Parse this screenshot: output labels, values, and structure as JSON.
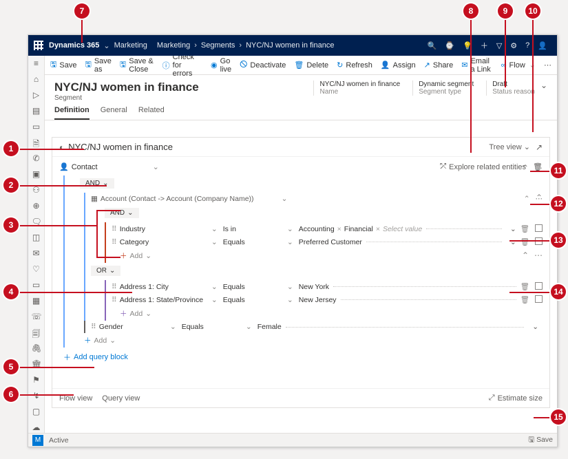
{
  "topnav": {
    "brand": "Dynamics 365",
    "app": "Marketing",
    "crumbs": [
      "Marketing",
      "Segments",
      "NYC/NJ women in finance"
    ]
  },
  "cmdbar": {
    "save": "Save",
    "saveas": "Save as",
    "saveclose": "Save & Close",
    "check": "Check for errors",
    "golive": "Go live",
    "deactivate": "Deactivate",
    "delete": "Delete",
    "refresh": "Refresh",
    "assign": "Assign",
    "share": "Share",
    "emaillink": "Email a Link",
    "flow": "Flow"
  },
  "header": {
    "title": "NYC/NJ women in finance",
    "subtitle": "Segment",
    "meta": [
      {
        "label": "NYC/NJ women in finance",
        "sub": "Name"
      },
      {
        "label": "Dynamic segment",
        "sub": "Segment type"
      },
      {
        "label": "Draft",
        "sub": "Status reason"
      }
    ]
  },
  "tabs": {
    "definition": "Definition",
    "general": "General",
    "related": "Related"
  },
  "panel": {
    "title": "NYC/NJ women in finance",
    "treeview": "Tree view",
    "exploreRelated": "Explore related entities",
    "flowview": "Flow view",
    "queryview": "Query view",
    "estimate": "Estimate size"
  },
  "query": {
    "rootEntity": "Contact",
    "and": "AND",
    "or": "OR",
    "accountRel": "Account (Contact -> Account (Company Name))",
    "clauses": {
      "industry": {
        "field": "Industry",
        "op": "Is in",
        "vals": [
          "Accounting",
          "Financial"
        ],
        "placeholder": "Select value"
      },
      "category": {
        "field": "Category",
        "op": "Equals",
        "val": "Preferred Customer"
      },
      "city": {
        "field": "Address 1: City",
        "op": "Equals",
        "val": "New York"
      },
      "state": {
        "field": "Address 1: State/Province",
        "op": "Equals",
        "val": "New Jersey"
      },
      "gender": {
        "field": "Gender",
        "op": "Equals",
        "val": "Female"
      }
    },
    "add": "Add",
    "addQueryBlock": "Add query block"
  },
  "status": {
    "badge": "M",
    "state": "Active",
    "save": "Save"
  },
  "callouts": {
    "1": "1",
    "2": "2",
    "3": "3",
    "4": "4",
    "5": "5",
    "6": "6",
    "7": "7",
    "8": "8",
    "9": "9",
    "10": "10",
    "11": "11",
    "12": "12",
    "13": "13",
    "14": "14",
    "15": "15"
  }
}
